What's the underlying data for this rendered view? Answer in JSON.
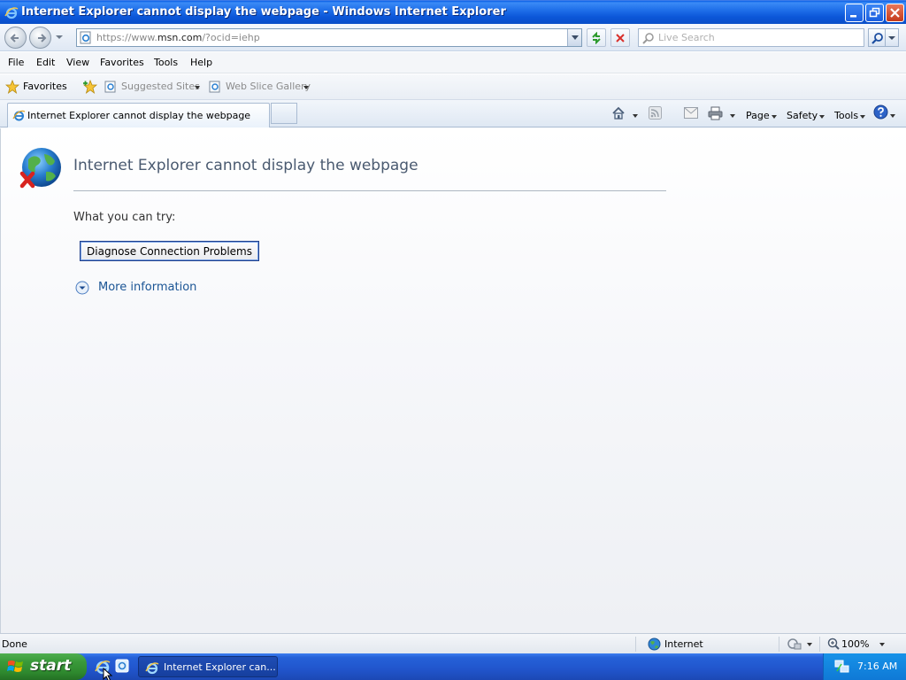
{
  "window": {
    "title": "Internet Explorer cannot display the webpage - Windows Internet Explorer",
    "icon": "ie-icon",
    "controls": [
      "minimize-icon",
      "restore-icon",
      "close-icon"
    ]
  },
  "navbar": {
    "url_prefix": "https://www.",
    "url_domain": "msn.com",
    "url_suffix": "/?ocid=iehp",
    "search_placeholder": "Live Search"
  },
  "menubar": {
    "items": [
      "File",
      "Edit",
      "View",
      "Favorites",
      "Tools",
      "Help"
    ]
  },
  "favorites_bar": {
    "favorites_label": "Favorites",
    "suggested_sites": "Suggested Sites",
    "web_slice_gallery": "Web Slice Gallery"
  },
  "tabs": {
    "active_tab_title": "Internet Explorer cannot display the webpage"
  },
  "command_bar": {
    "page": "Page",
    "safety": "Safety",
    "tools": "Tools"
  },
  "content": {
    "heading": "Internet Explorer cannot display the webpage",
    "what_you_can_try": "What you can try:",
    "diagnose_button": "Diagnose Connection Problems",
    "more_information": "More information"
  },
  "statusbar": {
    "status": "Done",
    "zone": "Internet",
    "zoom": "100%"
  },
  "taskbar": {
    "start_label": "start",
    "task_label": "Internet Explorer can...",
    "clock": "7:16 AM"
  },
  "colors": {
    "titlebar": "#0b56d9",
    "taskbar": "#2155cc",
    "start_button": "#3a9a3a",
    "link": "#1b5595",
    "heading": "#4a5a70"
  }
}
